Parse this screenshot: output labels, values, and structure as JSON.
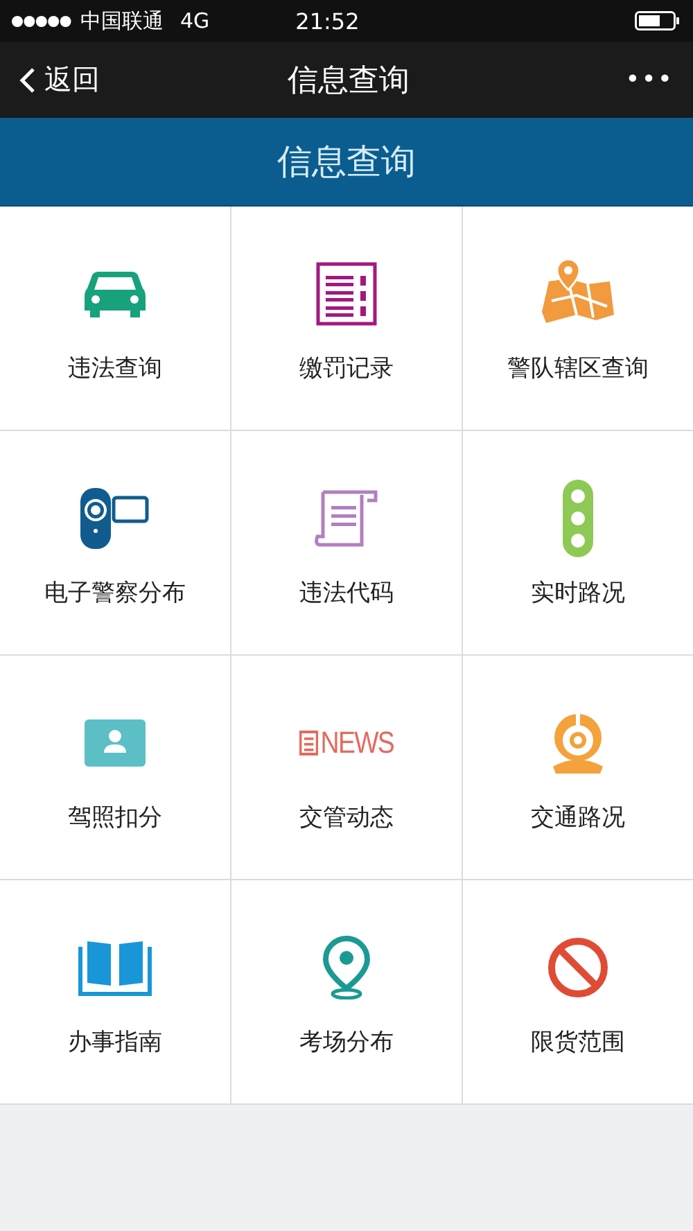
{
  "status_bar": {
    "carrier": "中国联通",
    "network": "4G",
    "time": "21:52"
  },
  "nav_bar": {
    "back": "返回",
    "title": "信息查询",
    "more": "•••"
  },
  "header": {
    "title": "信息查询"
  },
  "grid": [
    {
      "label": "违法查询",
      "kind": "car"
    },
    {
      "label": "缴罚记录",
      "kind": "receipt"
    },
    {
      "label": "警队辖区查询",
      "kind": "map"
    },
    {
      "label": "电子警察分布",
      "kind": "camera"
    },
    {
      "label": "违法代码",
      "kind": "scroll"
    },
    {
      "label": "实时路况",
      "kind": "traffic-light"
    },
    {
      "label": "驾照扣分",
      "kind": "id-card"
    },
    {
      "label": "交管动态",
      "kind": "news"
    },
    {
      "label": "交通路况",
      "kind": "webcam"
    },
    {
      "label": "办事指南",
      "kind": "book"
    },
    {
      "label": "考场分布",
      "kind": "pin"
    },
    {
      "label": "限货范围",
      "kind": "no-entry"
    }
  ],
  "news_icon": {
    "text": "NEWS"
  }
}
